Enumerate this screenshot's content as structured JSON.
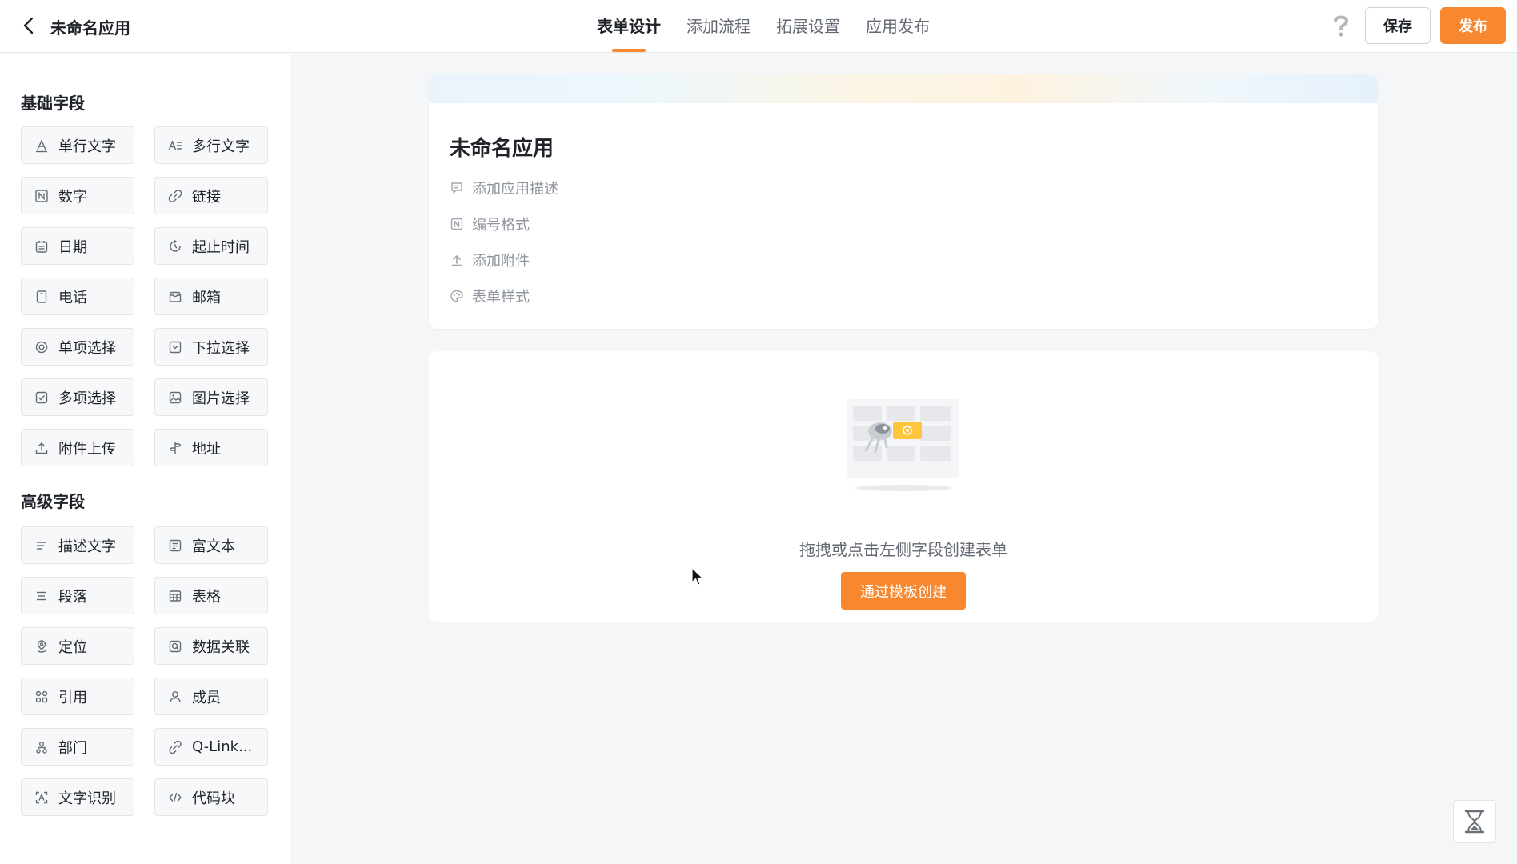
{
  "header": {
    "app_title": "未命名应用",
    "tabs": [
      {
        "label": "表单设计",
        "active": true
      },
      {
        "label": "添加流程",
        "active": false
      },
      {
        "label": "拓展设置",
        "active": false
      },
      {
        "label": "应用发布",
        "active": false
      }
    ],
    "save_label": "保存",
    "publish_label": "发布"
  },
  "sidebar": {
    "basic_title": "基础字段",
    "basic_fields": [
      {
        "label": "单行文字",
        "icon": "single-line-text-icon"
      },
      {
        "label": "多行文字",
        "icon": "multi-line-text-icon"
      },
      {
        "label": "数字",
        "icon": "number-icon"
      },
      {
        "label": "链接",
        "icon": "link-icon"
      },
      {
        "label": "日期",
        "icon": "calendar-icon"
      },
      {
        "label": "起止时间",
        "icon": "time-range-icon"
      },
      {
        "label": "电话",
        "icon": "phone-icon"
      },
      {
        "label": "邮箱",
        "icon": "mail-icon"
      },
      {
        "label": "单项选择",
        "icon": "radio-icon"
      },
      {
        "label": "下拉选择",
        "icon": "dropdown-icon"
      },
      {
        "label": "多项选择",
        "icon": "checkbox-icon"
      },
      {
        "label": "图片选择",
        "icon": "image-icon"
      },
      {
        "label": "附件上传",
        "icon": "upload-icon"
      },
      {
        "label": "地址",
        "icon": "address-icon"
      }
    ],
    "advanced_title": "高级字段",
    "advanced_fields": [
      {
        "label": "描述文字",
        "icon": "description-icon"
      },
      {
        "label": "富文本",
        "icon": "rich-text-icon"
      },
      {
        "label": "段落",
        "icon": "paragraph-icon"
      },
      {
        "label": "表格",
        "icon": "table-icon"
      },
      {
        "label": "定位",
        "icon": "location-icon"
      },
      {
        "label": "数据关联",
        "icon": "data-link-icon"
      },
      {
        "label": "引用",
        "icon": "reference-icon"
      },
      {
        "label": "成员",
        "icon": "member-icon"
      },
      {
        "label": "部门",
        "icon": "department-icon"
      },
      {
        "label": "Q-Link...",
        "icon": "q-link-icon"
      },
      {
        "label": "文字识别",
        "icon": "ocr-icon"
      },
      {
        "label": "代码块",
        "icon": "code-icon"
      }
    ]
  },
  "form": {
    "title": "未命名应用",
    "meta_items": [
      {
        "label": "添加应用描述",
        "icon": "comment-icon"
      },
      {
        "label": "编号格式",
        "icon": "number-format-icon"
      },
      {
        "label": "添加附件",
        "icon": "upload-icon"
      },
      {
        "label": "表单样式",
        "icon": "palette-icon"
      }
    ]
  },
  "empty_state": {
    "text": "拖拽或点击左侧字段创建表单",
    "button_label": "通过模板创建"
  },
  "colors": {
    "accent": "#f7882f",
    "text_primary": "#1f2329",
    "text_secondary": "#8f959e",
    "background": "#f5f6f8"
  }
}
